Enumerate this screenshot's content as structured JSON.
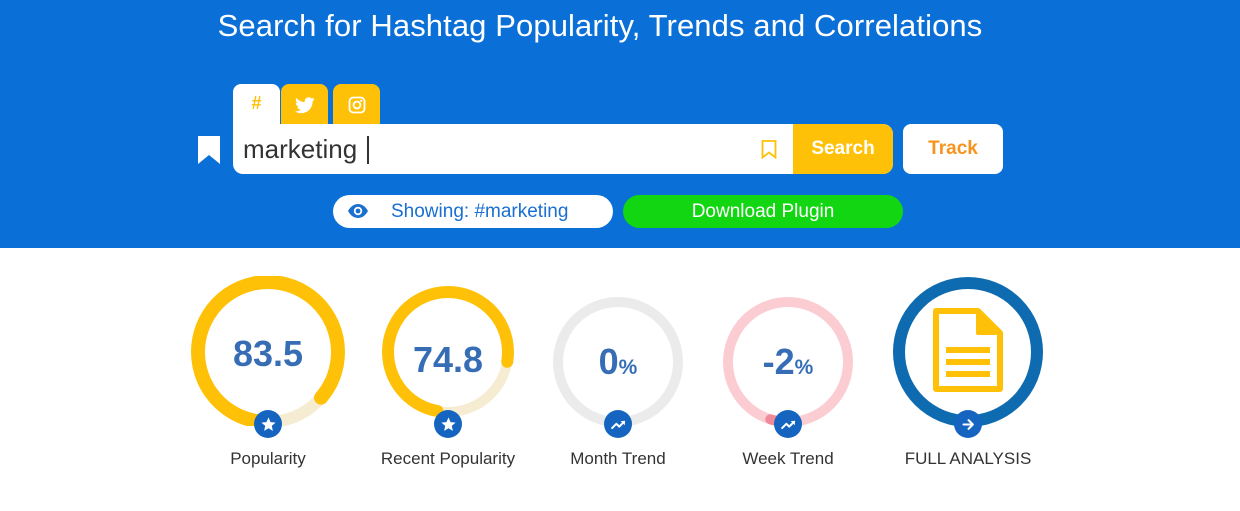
{
  "header": {
    "title": "Search for Hashtag Popularity, Trends and Correlations"
  },
  "tabs": [
    {
      "label": "#",
      "icon": "hashtag-icon",
      "active": true
    },
    {
      "label": "",
      "icon": "twitter-icon",
      "active": false
    },
    {
      "label": "",
      "icon": "instagram-icon",
      "active": false
    }
  ],
  "search": {
    "value": "marketing",
    "placeholder": "",
    "button_label": "Search",
    "bookmark_icon": "bookmark-icon"
  },
  "track": {
    "label": "Track"
  },
  "showing": {
    "text": "Showing: #marketing",
    "icon": "eye-icon"
  },
  "plugin": {
    "label": "Download Plugin"
  },
  "colors": {
    "header_bg": "#0a6fd6",
    "accent_yellow": "#ffc107",
    "track_orange": "#f5941e",
    "plugin_green": "#11d611",
    "value_blue": "#366db5",
    "badge_blue": "#1565c0"
  },
  "metrics": [
    {
      "value": "83.5",
      "unit": "",
      "label": "Popularity",
      "fill_percent": 83.5,
      "icon": "star-icon"
    },
    {
      "value": "74.8",
      "unit": "",
      "label": "Recent Popularity",
      "fill_percent": 74.8,
      "icon": "star-icon"
    },
    {
      "value": "0",
      "unit": "%",
      "label": "Month Trend",
      "fill_percent": 0,
      "icon": "trend-icon"
    },
    {
      "value": "-2",
      "unit": "%",
      "label": "Week Trend",
      "fill_percent": 2,
      "icon": "trend-icon"
    },
    {
      "value": "",
      "unit": "",
      "label": "FULL ANALYSIS",
      "icon": "document-icon"
    }
  ]
}
